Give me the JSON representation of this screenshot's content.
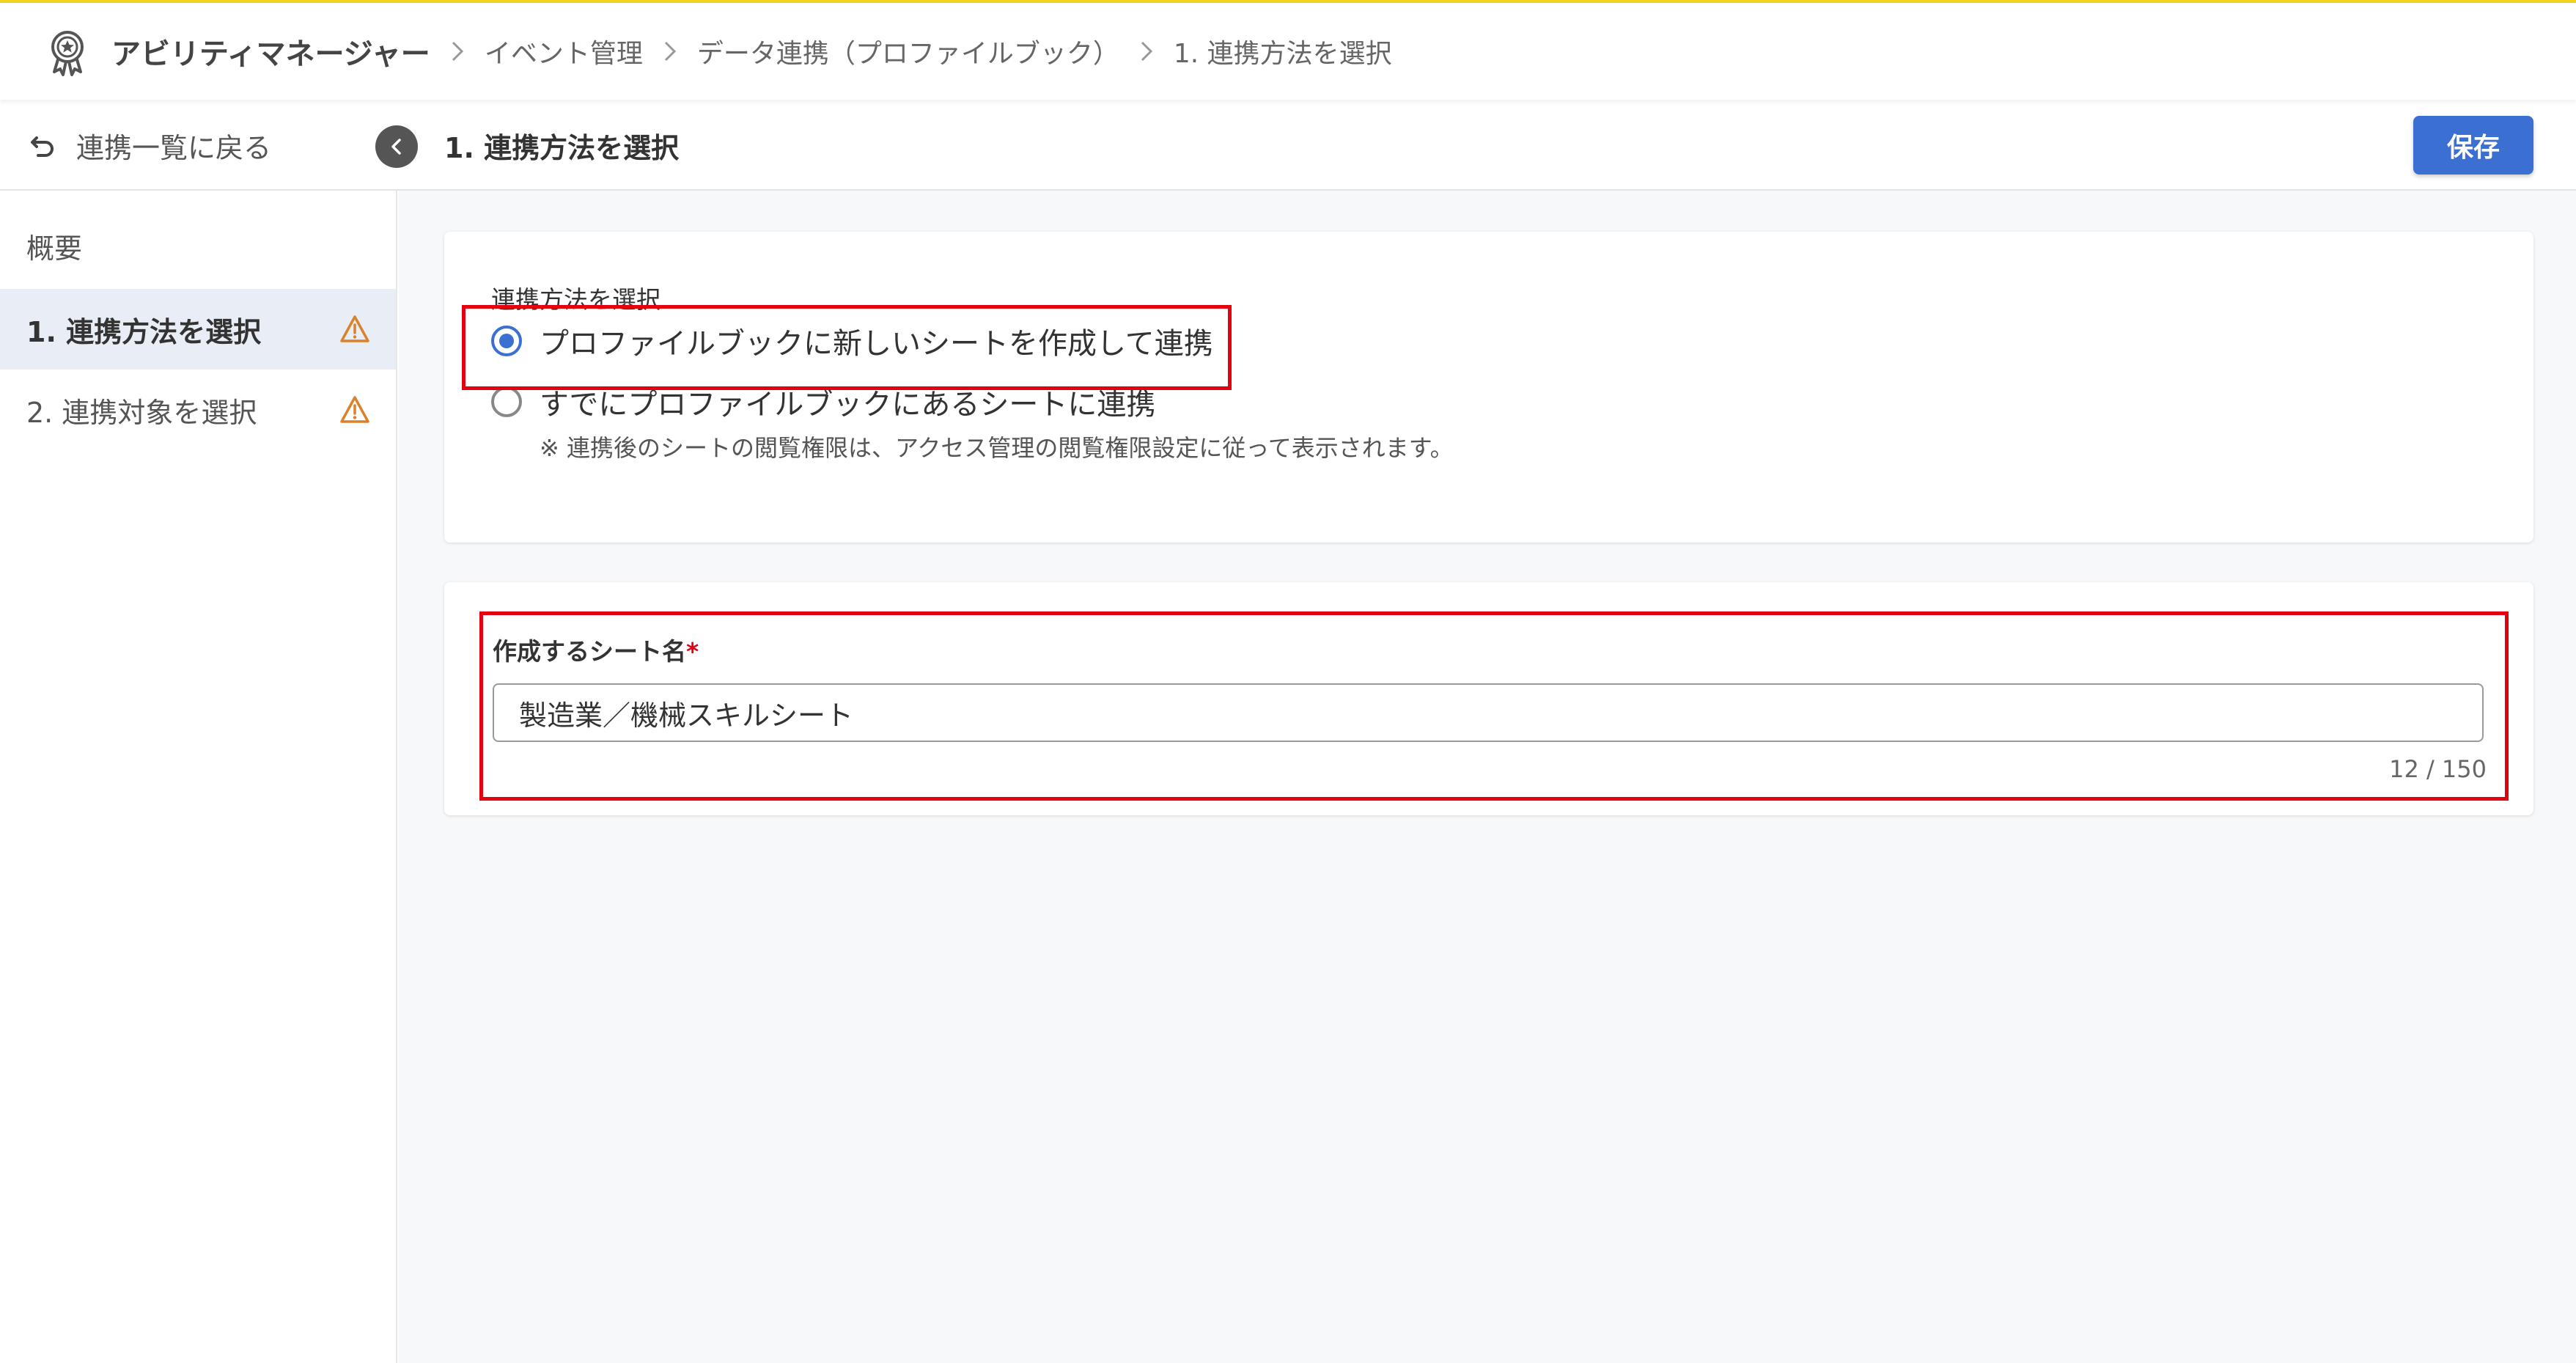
{
  "breadcrumb": {
    "app": "アビリティマネージャー",
    "items": [
      "イベント管理",
      "データ連携（プロファイルブック）",
      "1. 連携方法を選択"
    ]
  },
  "toolbar": {
    "back_label": "連携一覧に戻る",
    "page_title": "1. 連携方法を選択",
    "save_label": "保存"
  },
  "sidebar": {
    "items": [
      {
        "label": "概要"
      },
      {
        "label": "1. 連携方法を選択",
        "active": true,
        "warning": true
      },
      {
        "label": "2. 連携対象を選択",
        "warning": true
      }
    ]
  },
  "method_card": {
    "label": "連携方法を選択",
    "options": [
      {
        "label": "プロファイルブックに新しいシートを作成して連携",
        "selected": true
      },
      {
        "label": "すでにプロファイルブックにあるシートに連携",
        "selected": false
      }
    ],
    "note": "※ 連携後のシートの閲覧権限は、アクセス管理の閲覧権限設定に従って表示されます。"
  },
  "sheet_card": {
    "label": "作成するシート名",
    "required_mark": "*",
    "value": "製造業／機械スキルシート",
    "counter": "12 / 150"
  },
  "colors": {
    "accent": "#3c6fd2",
    "highlight": "#e3000f",
    "warning": "#d9822b",
    "top_line": "#f2d21c"
  }
}
